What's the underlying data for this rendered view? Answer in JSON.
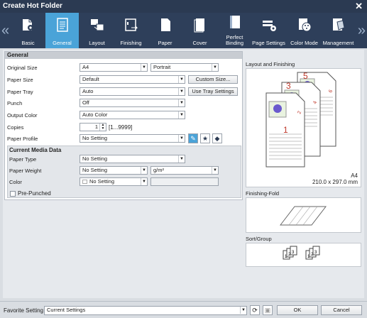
{
  "window": {
    "title": "Create Hot Folder",
    "close_glyph": "✕"
  },
  "tabs": [
    {
      "label": "Basic",
      "icon": "folder-gear-icon"
    },
    {
      "label": "General",
      "icon": "document-list-icon"
    },
    {
      "label": "Layout",
      "icon": "layout-icon"
    },
    {
      "label": "Finishing",
      "icon": "finishing-icon"
    },
    {
      "label": "Paper",
      "icon": "paper-icon"
    },
    {
      "label": "Cover",
      "icon": "cover-icon"
    },
    {
      "label": "Perfect Binding",
      "icon": "binding-icon"
    },
    {
      "label": "Page Settings",
      "icon": "page-settings-icon"
    },
    {
      "label": "Color Mode",
      "icon": "palette-icon"
    },
    {
      "label": "Management",
      "icon": "management-icon"
    }
  ],
  "nav": {
    "prev": "«",
    "next": "»"
  },
  "general": {
    "header": "General",
    "original_size": {
      "label": "Original Size",
      "value": "A4",
      "orientation": "Portrait"
    },
    "paper_size": {
      "label": "Paper Size",
      "value": "Default",
      "button": "Custom Size..."
    },
    "paper_tray": {
      "label": "Paper Tray",
      "value": "Auto",
      "button": "Use Tray Settings"
    },
    "punch": {
      "label": "Punch",
      "value": "Off"
    },
    "output_color": {
      "label": "Output Color",
      "value": "Auto Color"
    },
    "copies": {
      "label": "Copies",
      "value": "1",
      "range": "[1...9999]"
    },
    "paper_profile": {
      "label": "Paper Profile",
      "value": "No Setting"
    }
  },
  "media": {
    "header": "Current Media Data",
    "paper_type": {
      "label": "Paper Type",
      "value": "No Setting"
    },
    "paper_weight": {
      "label": "Paper Weight",
      "value": "No Setting",
      "unit": "g/m²"
    },
    "color": {
      "label": "Color",
      "value": "No Setting"
    },
    "pre_punched": {
      "label": "Pre-Punched",
      "checked": false
    }
  },
  "preview": {
    "layout_label": "Layout and Finishing",
    "page_numbers": [
      "5",
      "6",
      "3",
      "4",
      "1",
      "2"
    ],
    "size_name": "A4",
    "size_dims": "210.0 x 297.0 mm",
    "fold_label": "Finishing-Fold",
    "sort_label": "Sort/Group",
    "sort_digits": [
      "1",
      "2",
      "3",
      "1",
      "2",
      "3"
    ]
  },
  "footer": {
    "favorite_label": "Favorite Setting",
    "favorite_value": "Current Settings",
    "ok": "OK",
    "cancel": "Cancel"
  },
  "colors": {
    "accent": "#4aa3d8",
    "titlebar": "#2b3a52",
    "red": "#c0392b",
    "flower": "#6a5acd"
  }
}
